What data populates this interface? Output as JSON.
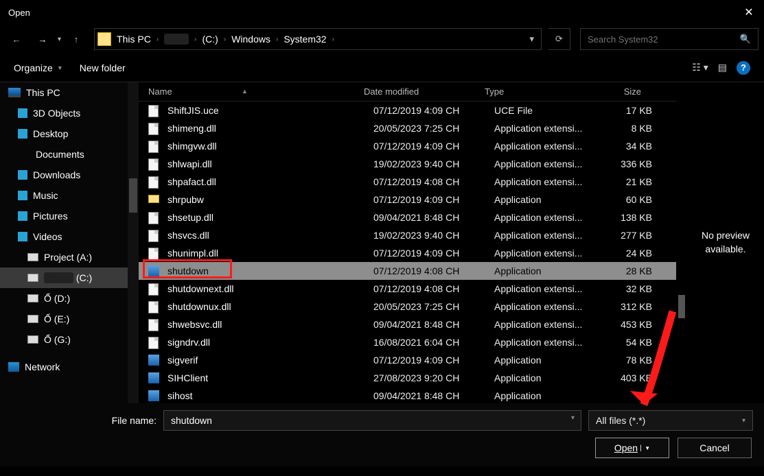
{
  "dialog": {
    "title": "Open"
  },
  "nav": {
    "back": "←",
    "fwd": "→",
    "up": "↑"
  },
  "breadcrumb": {
    "items": [
      "This PC",
      "(redact)",
      "(C:)",
      "Windows",
      "System32"
    ]
  },
  "search": {
    "placeholder": "Search System32"
  },
  "toolbar": {
    "organize": "Organize",
    "newfolder": "New folder"
  },
  "sidebar": {
    "items": [
      {
        "label": "This PC",
        "icon": "monitor",
        "root": true
      },
      {
        "label": "3D Objects",
        "icon": "cube"
      },
      {
        "label": "Desktop",
        "icon": "desktop"
      },
      {
        "label": "Documents",
        "icon": "doc"
      },
      {
        "label": "Downloads",
        "icon": "download"
      },
      {
        "label": "Music",
        "icon": "music"
      },
      {
        "label": "Pictures",
        "icon": "pictures"
      },
      {
        "label": "Videos",
        "icon": "video"
      },
      {
        "label": "Project (A:)",
        "icon": "drive",
        "indent": true
      },
      {
        "label": "(redact)  (C:)",
        "icon": "drive",
        "indent": true,
        "selected": true
      },
      {
        "label": "Ổ (D:)",
        "icon": "drive",
        "indent": true
      },
      {
        "label": "Ổ (E:)",
        "icon": "drive",
        "indent": true
      },
      {
        "label": "Ổ (G:)",
        "icon": "drive",
        "indent": true
      },
      {
        "label": "Network",
        "icon": "network",
        "root": true
      }
    ]
  },
  "columns": {
    "name": "Name",
    "date": "Date modified",
    "type": "Type",
    "size": "Size"
  },
  "files": [
    {
      "name": "ShiftJIS.uce",
      "date": "07/12/2019 4:09 CH",
      "type": "UCE File",
      "size": "17 KB",
      "icon": "gen"
    },
    {
      "name": "shimeng.dll",
      "date": "20/05/2023 7:25 CH",
      "type": "Application extensi...",
      "size": "8 KB",
      "icon": "gen"
    },
    {
      "name": "shimgvw.dll",
      "date": "07/12/2019 4:09 CH",
      "type": "Application extensi...",
      "size": "34 KB",
      "icon": "gen"
    },
    {
      "name": "shlwapi.dll",
      "date": "19/02/2023 9:40 CH",
      "type": "Application extensi...",
      "size": "336 KB",
      "icon": "gen"
    },
    {
      "name": "shpafact.dll",
      "date": "07/12/2019 4:08 CH",
      "type": "Application extensi...",
      "size": "21 KB",
      "icon": "gen"
    },
    {
      "name": "shrpubw",
      "date": "07/12/2019 4:09 CH",
      "type": "Application",
      "size": "60 KB",
      "icon": "folder"
    },
    {
      "name": "shsetup.dll",
      "date": "09/04/2021 8:48 CH",
      "type": "Application extensi...",
      "size": "138 KB",
      "icon": "gen"
    },
    {
      "name": "shsvcs.dll",
      "date": "19/02/2023 9:40 CH",
      "type": "Application extensi...",
      "size": "277 KB",
      "icon": "gen"
    },
    {
      "name": "shunimpl.dll",
      "date": "07/12/2019 4:09 CH",
      "type": "Application extensi...",
      "size": "24 KB",
      "icon": "gen"
    },
    {
      "name": "shutdown",
      "date": "07/12/2019 4:08 CH",
      "type": "Application",
      "size": "28 KB",
      "icon": "app",
      "selected": true,
      "highlight": true
    },
    {
      "name": "shutdownext.dll",
      "date": "07/12/2019 4:08 CH",
      "type": "Application extensi...",
      "size": "32 KB",
      "icon": "gen"
    },
    {
      "name": "shutdownux.dll",
      "date": "20/05/2023 7:25 CH",
      "type": "Application extensi...",
      "size": "312 KB",
      "icon": "gen"
    },
    {
      "name": "shwebsvc.dll",
      "date": "09/04/2021 8:48 CH",
      "type": "Application extensi...",
      "size": "453 KB",
      "icon": "gen"
    },
    {
      "name": "signdrv.dll",
      "date": "16/08/2021 6:04 CH",
      "type": "Application extensi...",
      "size": "54 KB",
      "icon": "gen"
    },
    {
      "name": "sigverif",
      "date": "07/12/2019 4:09 CH",
      "type": "Application",
      "size": "78 KB",
      "icon": "app"
    },
    {
      "name": "SIHClient",
      "date": "27/08/2023 9:20 CH",
      "type": "Application",
      "size": "403 KB",
      "icon": "app"
    },
    {
      "name": "sihost",
      "date": "09/04/2021 8:48 CH",
      "type": "Application",
      "size": "",
      "icon": "app"
    }
  ],
  "preview": {
    "text": "No preview available."
  },
  "footer": {
    "filename_label": "File name:",
    "filename_value": "shutdown",
    "filter": "All files (*.*)",
    "open": "Open",
    "cancel": "Cancel"
  }
}
